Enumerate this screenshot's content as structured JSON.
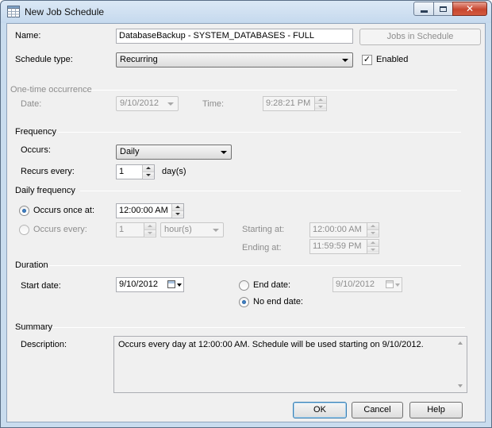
{
  "window": {
    "title": "New Job Schedule",
    "icon": "calendar-grid-icon"
  },
  "name": {
    "label": "Name:",
    "value": "DatabaseBackup - SYSTEM_DATABASES - FULL",
    "jobs_button": "Jobs in Schedule"
  },
  "schedule_type": {
    "label": "Schedule type:",
    "value": "Recurring",
    "enabled_label": "Enabled",
    "enabled_checked": true
  },
  "one_time": {
    "header": "One-time occurrence",
    "date_label": "Date:",
    "date_value": "9/10/2012",
    "time_label": "Time:",
    "time_value": "9:28:21 PM"
  },
  "frequency": {
    "header": "Frequency",
    "occurs_label": "Occurs:",
    "occurs_value": "Daily",
    "recurs_label": "Recurs every:",
    "recurs_value": "1",
    "recurs_unit": "day(s)"
  },
  "daily_frequency": {
    "header": "Daily frequency",
    "once_label": "Occurs once at:",
    "once_value": "12:00:00 AM",
    "once_selected": true,
    "every_label": "Occurs every:",
    "every_value": "1",
    "every_unit": "hour(s)",
    "starting_label": "Starting at:",
    "starting_value": "12:00:00 AM",
    "ending_label": "Ending at:",
    "ending_value": "11:59:59 PM"
  },
  "duration": {
    "header": "Duration",
    "start_label": "Start date:",
    "start_value": "9/10/2012",
    "end_label": "End date:",
    "end_value": "9/10/2012",
    "no_end_label": "No end date:",
    "no_end_selected": true
  },
  "summary": {
    "header": "Summary",
    "description_label": "Description:",
    "description_text": "Occurs every day at 12:00:00 AM. Schedule will be used starting on 9/10/2012."
  },
  "buttons": {
    "ok": "OK",
    "cancel": "Cancel",
    "help": "Help"
  }
}
